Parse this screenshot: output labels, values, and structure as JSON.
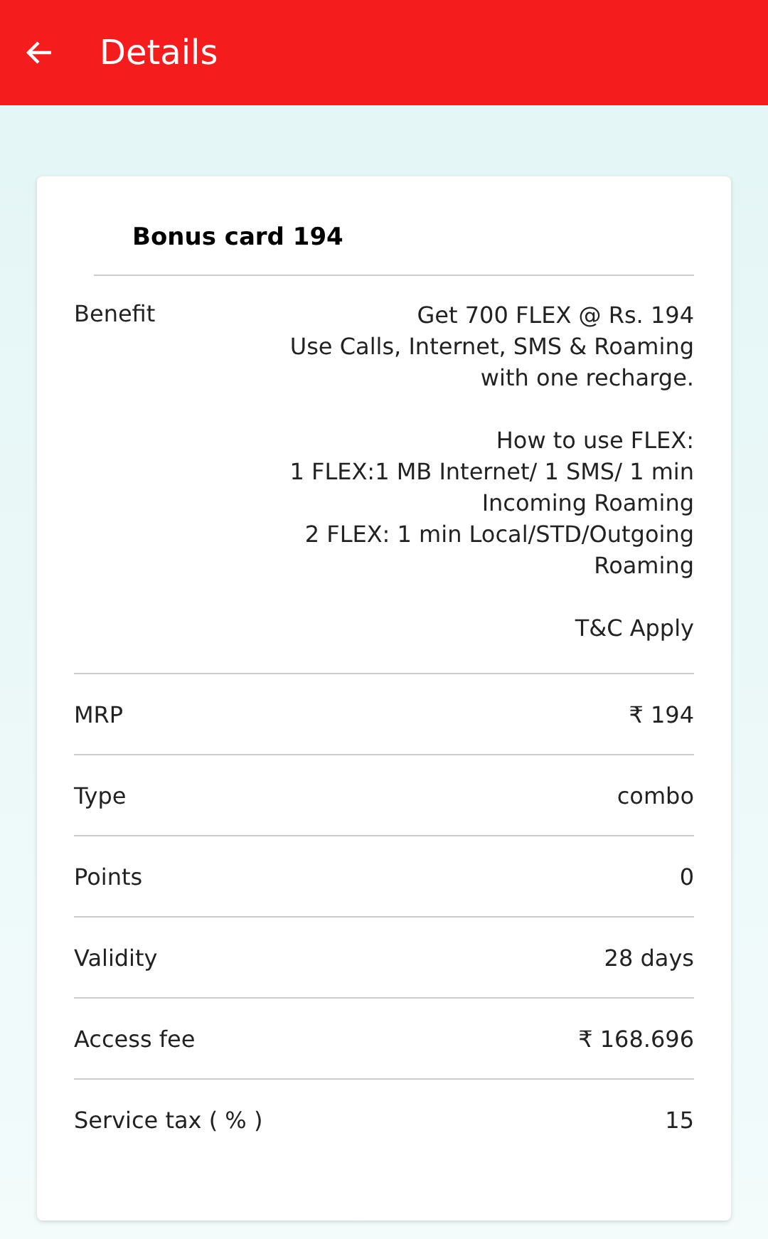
{
  "app_bar": {
    "title": "Details"
  },
  "card": {
    "title": "Bonus card 194",
    "benefit": {
      "label": "Benefit",
      "paragraphs": [
        [
          "Get 700 FLEX @ Rs. 194",
          "Use Calls, Internet, SMS & Roaming",
          "with one recharge."
        ],
        [
          "How to use FLEX:",
          "1 FLEX:1 MB Internet/ 1 SMS/ 1 min",
          "Incoming Roaming",
          "2 FLEX: 1 min Local/STD/Outgoing",
          "Roaming"
        ],
        [
          "T&C Apply"
        ]
      ]
    },
    "rows": [
      {
        "label": "MRP",
        "value": "₹ 194"
      },
      {
        "label": "Type",
        "value": "combo"
      },
      {
        "label": "Points",
        "value": "0"
      },
      {
        "label": "Validity",
        "value": "28 days"
      },
      {
        "label": "Access fee",
        "value": "₹ 168.696"
      },
      {
        "label": "Service tax ( % )",
        "value": "15"
      }
    ]
  }
}
